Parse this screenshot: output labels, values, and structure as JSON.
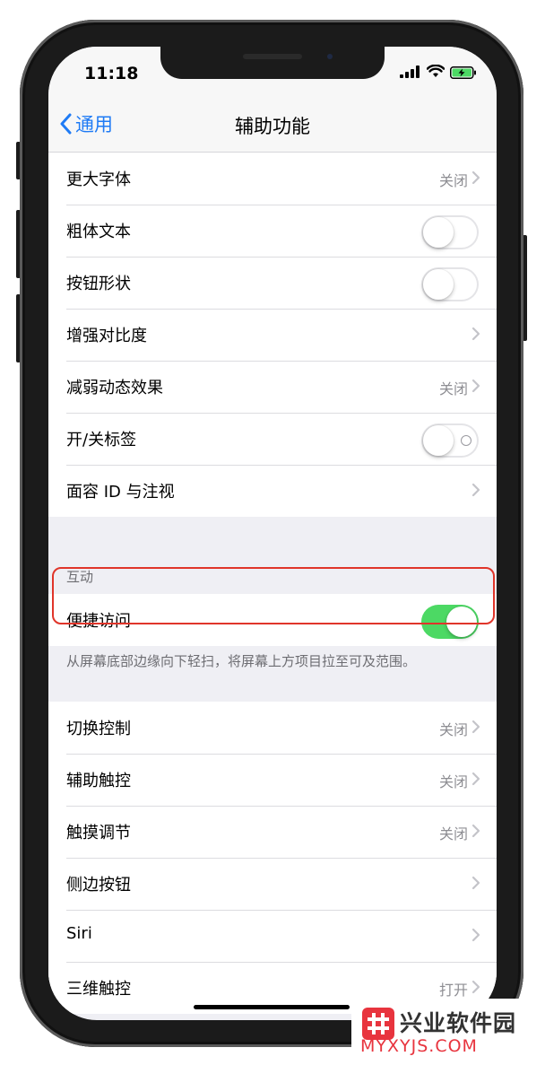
{
  "status_bar": {
    "time": "11:18"
  },
  "nav": {
    "back_label": "通用",
    "title": "辅助功能"
  },
  "group1": [
    {
      "label": "更大字体",
      "value": "关闭",
      "control": "chevron"
    },
    {
      "label": "粗体文本",
      "control": "toggle",
      "state": false
    },
    {
      "label": "按钮形状",
      "control": "toggle",
      "state": false
    },
    {
      "label": "增强对比度",
      "control": "chevron"
    },
    {
      "label": "减弱动态效果",
      "value": "关闭",
      "control": "chevron"
    },
    {
      "label": "开/关标签",
      "control": "toggle",
      "state": false
    },
    {
      "label": "面容 ID 与注视",
      "control": "chevron"
    }
  ],
  "interaction": {
    "header": "互动",
    "reachability": {
      "label": "便捷访问",
      "state": true
    },
    "footer": "从屏幕底部边缘向下轻扫，将屏幕上方项目拉至可及范围。"
  },
  "group2": [
    {
      "label": "切换控制",
      "value": "关闭",
      "control": "chevron"
    },
    {
      "label": "辅助触控",
      "value": "关闭",
      "control": "chevron"
    },
    {
      "label": "触摸调节",
      "value": "关闭",
      "control": "chevron"
    },
    {
      "label": "侧边按钮",
      "control": "chevron"
    },
    {
      "label": "Siri",
      "control": "chevron"
    },
    {
      "label": "三维触控",
      "value": "打开",
      "control": "chevron"
    }
  ],
  "watermark": {
    "name": "兴业软件园",
    "url": "MYXYJS.COM"
  },
  "colors": {
    "accent": "#1f7bf5",
    "toggle_on": "#4cd964",
    "highlight": "#e0352a",
    "watermark": "#e8343e"
  }
}
